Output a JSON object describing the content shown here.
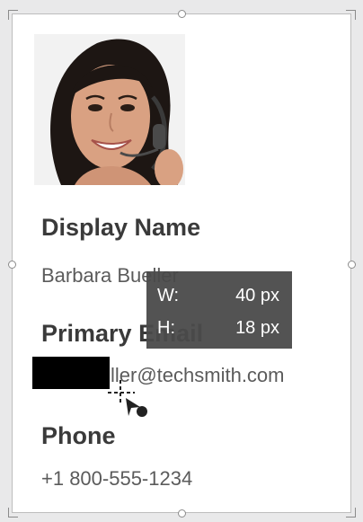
{
  "profile": {
    "display_name_label": "Display Name",
    "display_name_value": "Barbara Bueller",
    "email_label": "Primary Email",
    "email_value_visible": "ller@techsmith.com",
    "phone_label": "Phone",
    "phone_value": "+1 800-555-1234"
  },
  "tooltip": {
    "width_label": "W:",
    "width_value": "40 px",
    "height_label": "H:",
    "height_value": "18 px"
  },
  "icons": {
    "cursor": "crosshair-selection-icon",
    "avatar": "avatar-photo"
  },
  "colors": {
    "card_bg": "#ffffff",
    "label_text": "#3a3a3a",
    "value_text": "#5b5b5b",
    "tooltip_bg": "#4a4a4a",
    "redaction": "#000000"
  }
}
